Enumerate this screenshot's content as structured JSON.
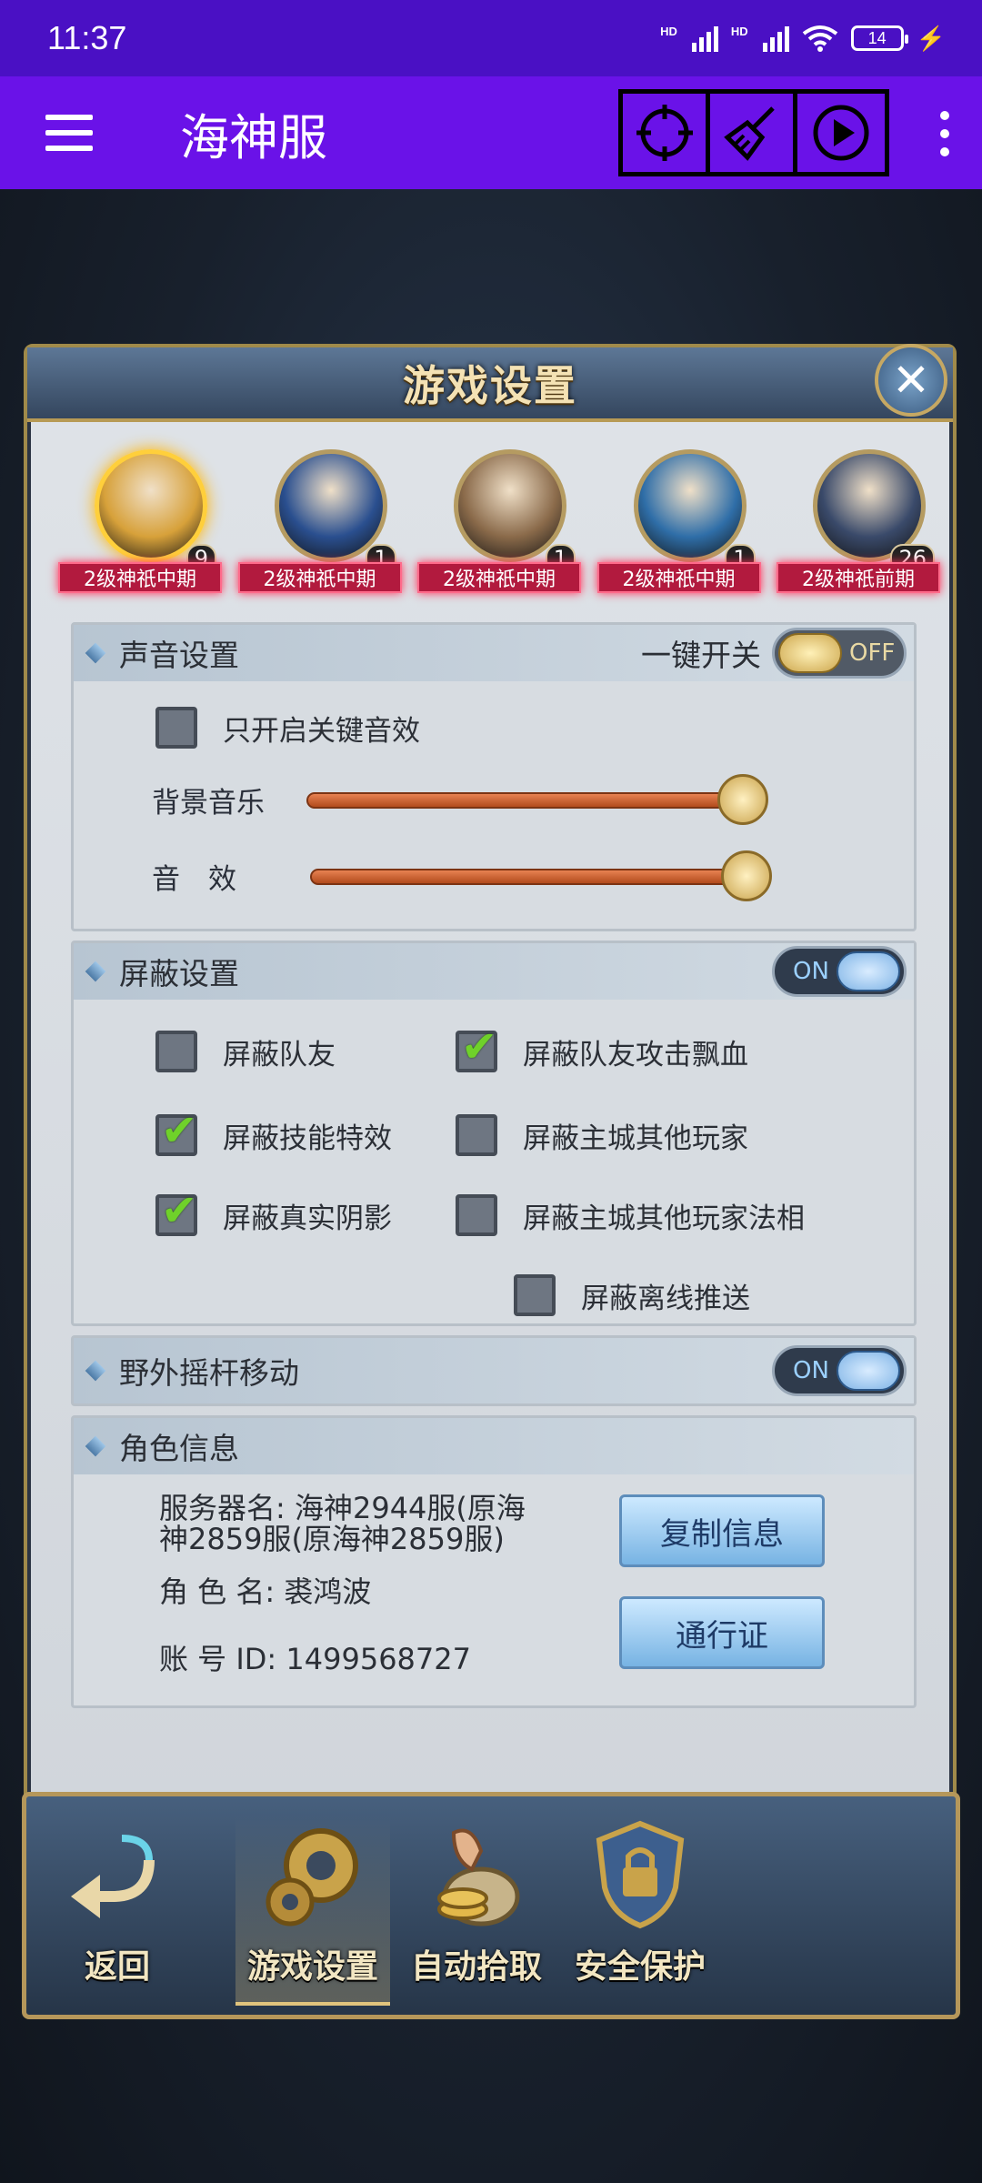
{
  "status_bar": {
    "time": "11:37",
    "signal1_label": "HD",
    "signal2_label": "HD",
    "battery": "14"
  },
  "app_bar": {
    "title": "海神服",
    "tools": [
      "crosshair-icon",
      "broom-icon",
      "play-icon"
    ]
  },
  "dialog": {
    "title": "游戏设置",
    "avatars": [
      {
        "count": "9",
        "tag": "2级神祇中期",
        "active": true,
        "color": "#d7a13a"
      },
      {
        "count": "1",
        "tag": "2级神祇中期",
        "active": false,
        "color": "#2a4f8f"
      },
      {
        "count": "1",
        "tag": "2级神祇中期",
        "active": false,
        "color": "#8a6a4a"
      },
      {
        "count": "1",
        "tag": "2级神祇中期",
        "active": false,
        "color": "#2f6ea8"
      },
      {
        "count": "26",
        "tag": "2级神祇前期",
        "active": false,
        "color": "#3a4a6a"
      }
    ],
    "sound": {
      "title": "声音设置",
      "master_label": "一键开关",
      "master_state": "OFF",
      "key_sfx_label": "只开启关键音效",
      "bgm_label": "背景音乐",
      "sfx_label": "音　效",
      "bgm_level": 1.0,
      "sfx_level": 1.0
    },
    "shield": {
      "title": "屏蔽设置",
      "state": "ON",
      "items": [
        {
          "label": "屏蔽队友",
          "checked": false
        },
        {
          "label": "屏蔽队友攻击飘血",
          "checked": true
        },
        {
          "label": "屏蔽技能特效",
          "checked": true
        },
        {
          "label": "屏蔽主城其他玩家",
          "checked": false
        },
        {
          "label": "屏蔽真实阴影",
          "checked": true
        },
        {
          "label": "屏蔽主城其他玩家法相",
          "checked": false
        },
        {
          "label": "屏蔽离线推送",
          "checked": false
        }
      ]
    },
    "joystick": {
      "title": "野外摇杆移动",
      "state": "ON"
    },
    "role": {
      "title": "角色信息",
      "server_label": "服务器名:",
      "server_value_line1": "海神2944服(原海",
      "server_value_line2": "神2859服(原海神2859服)",
      "name_label": "角 色 名:",
      "name_value": "裘鸿波",
      "id_label": "账 号 ID:",
      "id_value": "1499568727",
      "copy_button": "复制信息",
      "pass_button": "通行证"
    }
  },
  "bottom_nav": {
    "back": "返回",
    "items": [
      "游戏设置",
      "自动拾取",
      "安全保护"
    ]
  },
  "colors": {
    "status_bar": "#4a10c4",
    "app_bar": "#6a12e8",
    "accent_gold": "#b5975a"
  }
}
